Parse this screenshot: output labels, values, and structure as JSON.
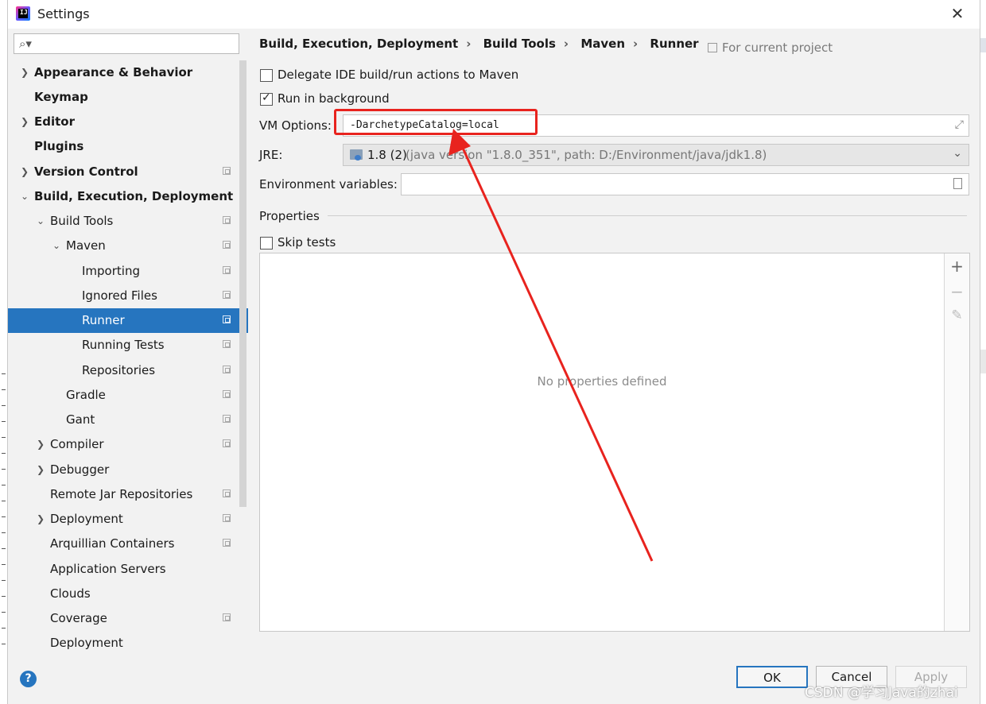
{
  "window": {
    "title": "Settings"
  },
  "search": {
    "placeholder": ""
  },
  "sidebar": {
    "items": [
      {
        "label": "Appearance & Behavior",
        "bold": true
      },
      {
        "label": "Keymap",
        "bold": true
      },
      {
        "label": "Editor",
        "bold": true
      },
      {
        "label": "Plugins",
        "bold": true
      },
      {
        "label": "Version Control",
        "bold": true
      },
      {
        "label": "Build, Execution, Deployment",
        "bold": true
      },
      {
        "label": "Build Tools"
      },
      {
        "label": "Maven"
      },
      {
        "label": "Importing"
      },
      {
        "label": "Ignored Files"
      },
      {
        "label": "Runner",
        "selected": true
      },
      {
        "label": "Running Tests"
      },
      {
        "label": "Repositories"
      },
      {
        "label": "Gradle"
      },
      {
        "label": "Gant"
      },
      {
        "label": "Compiler"
      },
      {
        "label": "Debugger"
      },
      {
        "label": "Remote Jar Repositories"
      },
      {
        "label": "Deployment"
      },
      {
        "label": "Arquillian Containers"
      },
      {
        "label": "Application Servers"
      },
      {
        "label": "Clouds"
      },
      {
        "label": "Coverage"
      },
      {
        "label": "Deployment"
      }
    ]
  },
  "breadcrumb": [
    "Build, Execution, Deployment",
    "Build Tools",
    "Maven",
    "Runner"
  ],
  "for_current_project": "For current project",
  "options": {
    "delegate": {
      "label": "Delegate IDE build/run actions to Maven",
      "checked": false
    },
    "background": {
      "label": "Run in background",
      "checked": true
    }
  },
  "fields": {
    "vm_label": "VM Options:",
    "vm_value": "-DarchetypeCatalog=local",
    "jre_label": "JRE:",
    "jre_value": "1.8 (2)",
    "jre_detail": "(java version \"1.8.0_351\", path: D:/Environment/java/jdk1.8)",
    "env_label": "Environment variables:",
    "env_value": ""
  },
  "properties": {
    "title": "Properties",
    "skip_tests": {
      "label": "Skip tests",
      "checked": false
    },
    "empty_text": "No properties defined"
  },
  "buttons": {
    "ok": "OK",
    "cancel": "Cancel",
    "apply": "Apply",
    "help": "?"
  },
  "annotation": {
    "color": "#e8231e"
  },
  "watermark": "CSDN @学习Java的zhai",
  "colors": {
    "selection": "#2675bf",
    "background": "#f2f2f2"
  }
}
